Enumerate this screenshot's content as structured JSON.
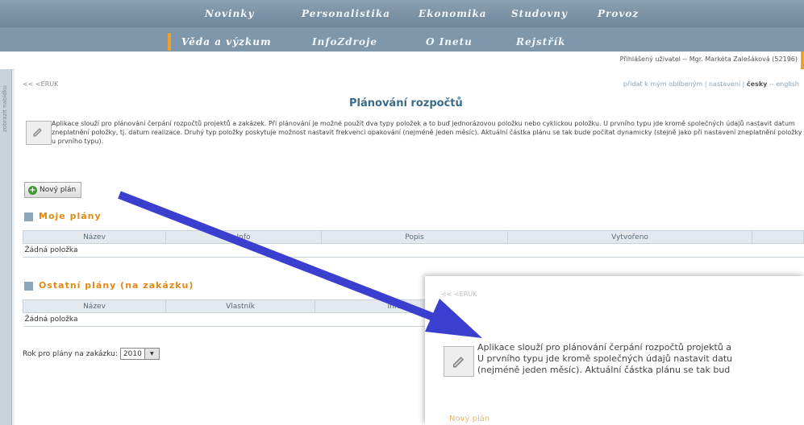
{
  "nav": {
    "row1": [
      "Novinky",
      "Personalistika",
      "Ekonomika",
      "Studovny",
      "Provoz"
    ],
    "row2": [
      "Věda a výzkum",
      "InfoZdroje",
      "O Inetu",
      "Rejstřík"
    ]
  },
  "userbar": {
    "text": "Přihlášený uživatel -- Mgr. Markéta Zalešáková (52196)"
  },
  "sidebar": {
    "text": "zobrazit nabídku"
  },
  "crumb": "<< <ERUK",
  "toplinks": {
    "favorite": "přidat k mým oblíbeným",
    "sep1": " | ",
    "settings": "nastavení",
    "sep2": " | ",
    "lang_cz": "česky",
    "lang_sep": " -- ",
    "lang_en": "english"
  },
  "title": "Plánování rozpočtů",
  "description": "Aplikace slouží pro plánování čerpání rozpočtů projektů a zakázek. Při plánování je možné použít dva typy položek a to buď jednorázovou položku nebo cyklickou položku. U prvního typu jde kromě společných údajů nastavit datum zneplatnění položky, tj. datum realizace. Druhý typ položky poskytuje možnost nastavit frekvenci opakování (nejméně jeden měsíc). Aktuální částka plánu se tak bude počítat dynamicky (stejně jako při nastavení zneplatnění položky u prvního typu).",
  "new_plan_label": "Nový plán",
  "my_plans": {
    "heading": "Moje plány",
    "columns": [
      "Název",
      "Info",
      "Popis",
      "Vytvořeno",
      ""
    ],
    "empty": "Žádná položka"
  },
  "other_plans": {
    "heading": "Ostatní plány (na zakázku)",
    "columns": [
      "Název",
      "Vlastník",
      "Info"
    ],
    "empty": "Žádná položka"
  },
  "year": {
    "label": "Rok pro plány na zakázku:",
    "value": "2010"
  },
  "zoom": {
    "crumb": "<< <ERUK",
    "line1": "Aplikace slouží pro plánování čerpání rozpočtů projektů a",
    "line2": "U prvního typu jde kromě společných údajů nastavit datu",
    "line3": "(nejméně jeden měsíc). Aktuální částka plánu se tak bud",
    "button": "Nový plán"
  },
  "colors": {
    "accent": "#f2a02d",
    "nav": "#7f97ab",
    "title": "#3a6b8c",
    "arrow": "#3a3fd0"
  }
}
